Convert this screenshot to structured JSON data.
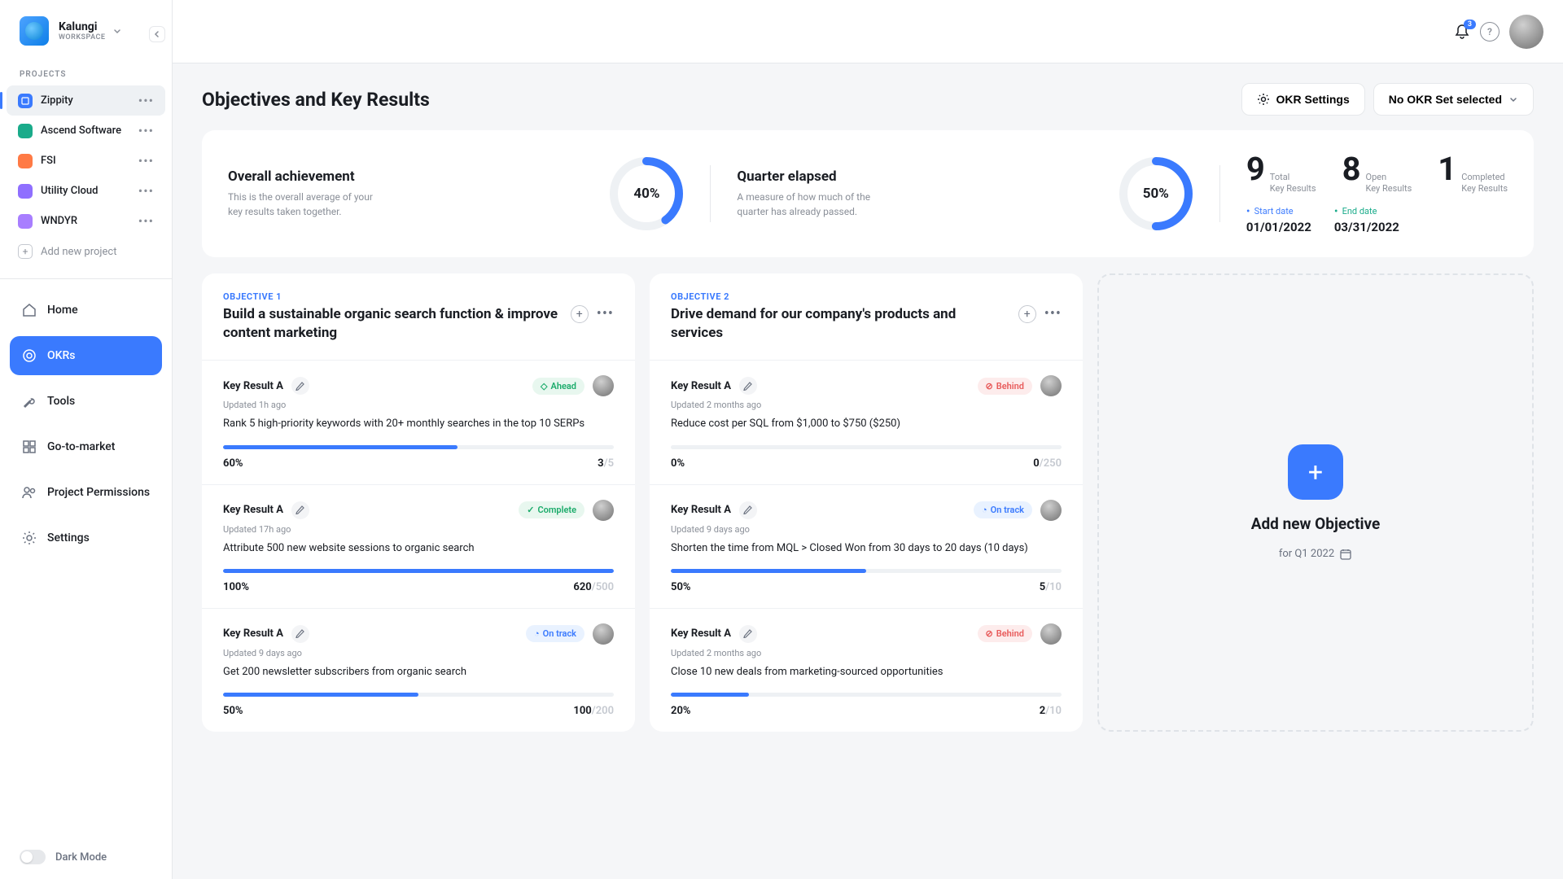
{
  "workspace": {
    "name": "Kalungi",
    "sub": "WORKSPACE"
  },
  "sidebar": {
    "projects_label": "PROJECTS",
    "projects": [
      {
        "name": "Zippity",
        "color": "#3a7afe"
      },
      {
        "name": "Ascend Software",
        "color": "#1aab8a"
      },
      {
        "name": "FSI",
        "color": "#ff7a45"
      },
      {
        "name": "Utility Cloud",
        "color": "#8f6fff"
      },
      {
        "name": "WNDYR",
        "color": "#a87eff"
      }
    ],
    "add_project": "Add new project",
    "nav": {
      "home": "Home",
      "okrs": "OKRs",
      "tools": "Tools",
      "gtm": "Go-to-market",
      "permissions": "Project Permissions",
      "settings": "Settings"
    },
    "dark_mode": "Dark Mode"
  },
  "topbar": {
    "notif_count": "3"
  },
  "page": {
    "title": "Objectives and Key Results",
    "settings_btn": "OKR Settings",
    "set_selector": "No OKR Set selected"
  },
  "dashboard": {
    "overall": {
      "title": "Overall achievement",
      "desc": "This is the overall average of your key results taken together.",
      "pct": "40%",
      "val": 40
    },
    "quarter": {
      "title": "Quarter elapsed",
      "desc": "A measure of how much of the quarter has already passed.",
      "pct": "50%",
      "val": 50
    },
    "stats": {
      "total": {
        "num": "9",
        "label1": "Total",
        "label2": "Key Results"
      },
      "open": {
        "num": "8",
        "label1": "Open",
        "label2": "Key Results"
      },
      "completed": {
        "num": "1",
        "label1": "Completed",
        "label2": "Key Results"
      }
    },
    "dates": {
      "start_label": "Start date",
      "start_val": "01/01/2022",
      "end_label": "End date",
      "end_val": "03/31/2022"
    }
  },
  "objectives": [
    {
      "number": "OBJECTIVE 1",
      "title": "Build a sustainable organic search function & improve content marketing",
      "krs": [
        {
          "name": "Key Result A",
          "updated": "Updated 1h ago",
          "desc": "Rank 5 high-priority keywords with 20+ monthly searches in the top 10 SERPs",
          "status": "Ahead",
          "status_class": "ahead",
          "pct": "60%",
          "pct_val": 60,
          "cur": "3",
          "tgt": "/5"
        },
        {
          "name": "Key Result A",
          "updated": "Updated 17h ago",
          "desc": "Attribute 500 new website sessions to organic search",
          "status": "Complete",
          "status_class": "complete",
          "pct": "100%",
          "pct_val": 100,
          "cur": "620",
          "tgt": "/500"
        },
        {
          "name": "Key Result A",
          "updated": "Updated 9 days ago",
          "desc": "Get 200 newsletter subscribers from organic search",
          "status": "On track",
          "status_class": "ontrack",
          "pct": "50%",
          "pct_val": 50,
          "cur": "100",
          "tgt": "/200"
        }
      ]
    },
    {
      "number": "OBJECTIVE 2",
      "title": "Drive demand for our company's products and services",
      "krs": [
        {
          "name": "Key Result A",
          "updated": "Updated 2 months ago",
          "desc": "Reduce cost per SQL from $1,000 to $750 ($250)",
          "status": "Behind",
          "status_class": "behind",
          "pct": "0%",
          "pct_val": 0,
          "cur": "0",
          "tgt": "/250"
        },
        {
          "name": "Key Result A",
          "updated": "Updated 9 days ago",
          "desc": "Shorten the time from MQL > Closed Won from 30 days to 20 days (10 days)",
          "status": "On track",
          "status_class": "ontrack",
          "pct": "50%",
          "pct_val": 50,
          "cur": "5",
          "tgt": "/10"
        },
        {
          "name": "Key Result A",
          "updated": "Updated 2 months ago",
          "desc": "Close 10 new deals from marketing-sourced opportunities",
          "status": "Behind",
          "status_class": "behind",
          "pct": "20%",
          "pct_val": 20,
          "cur": "2",
          "tgt": "/10"
        }
      ]
    }
  ],
  "new_obj": {
    "title": "Add new Objective",
    "sub": "for Q1 2022"
  }
}
